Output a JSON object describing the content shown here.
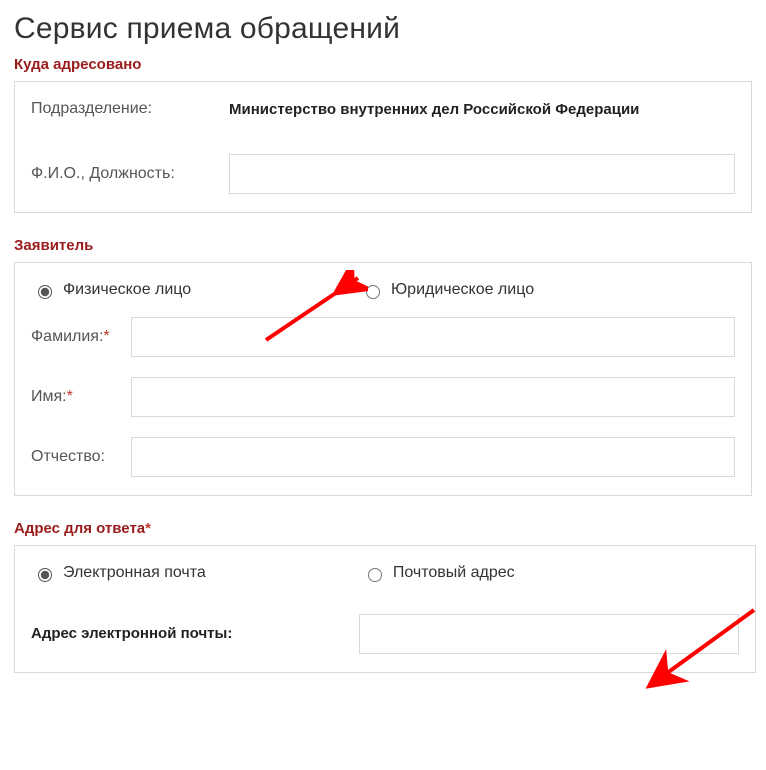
{
  "page": {
    "title": "Сервис приема обращений"
  },
  "addressed": {
    "header": "Куда адресовано",
    "department_label": "Подразделение:",
    "department_value": "Министерство внутренних дел Российской Федерации",
    "fio_label": "Ф.И.О., Должность:",
    "fio_value": ""
  },
  "applicant": {
    "header": "Заявитель",
    "type_individual": "Физическое лицо",
    "type_legal": "Юридическое лицо",
    "selected": "individual",
    "surname_label": "Фамилия:",
    "name_label": "Имя:",
    "patronymic_label": "Отчество:",
    "surname_value": "",
    "name_value": "",
    "patronymic_value": ""
  },
  "reply": {
    "header": "Адрес для ответа",
    "type_email": "Электронная почта",
    "type_postal": "Почтовый адрес",
    "selected": "email",
    "email_label": "Адрес электронной почты:",
    "email_value": ""
  }
}
